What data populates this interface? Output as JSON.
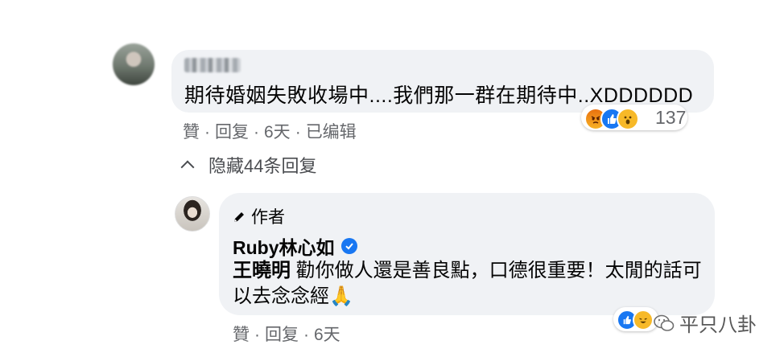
{
  "comment1": {
    "author_name": "",
    "text": "期待婚姻失敗收場中....我們那一群在期待中..XDDDDDD",
    "reactions": [
      "angry-icon",
      "like-icon",
      "wow-icon"
    ],
    "reaction_count": "137",
    "actions": {
      "like": "贊",
      "reply": "回复",
      "time": "6天",
      "edited": "已编辑"
    }
  },
  "hide_replies": {
    "label": "隐藏44条回复"
  },
  "reply1": {
    "badge": "作者",
    "author_name": "Ruby林心如",
    "mention": "王曉明",
    "text": " 勸你做人還是善良點，口德很重要！太閒的話可以去念念經",
    "emoji": "🙏",
    "reactions": [
      "like-icon",
      "haha-icon"
    ],
    "actions": {
      "like": "贊",
      "reply": "回复",
      "time": "6天"
    }
  },
  "watermark": {
    "text": "平只八卦"
  },
  "colors": {
    "bubble_bg": "#f0f2f5",
    "meta_text": "#65676b",
    "facebook_blue": "#1877f2"
  }
}
